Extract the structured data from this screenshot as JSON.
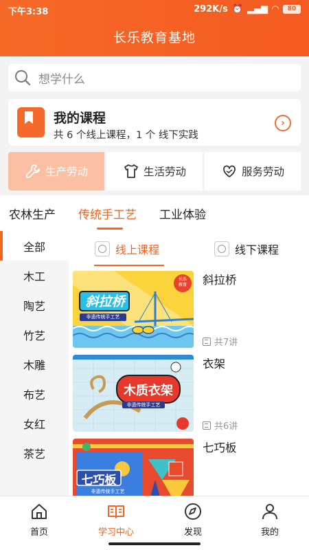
{
  "status": {
    "time": "下午3:38",
    "speed": "292K/s",
    "battery": "80"
  },
  "app": {
    "title": "长乐教育基地"
  },
  "search": {
    "placeholder": "想学什么"
  },
  "my_course": {
    "title": "我的课程",
    "summary": "共 6 个线上课程，1 个 线下实践"
  },
  "categories": [
    {
      "label": "生产劳动",
      "icon": "wrench-icon"
    },
    {
      "label": "生活劳动",
      "icon": "shirt-icon"
    },
    {
      "label": "服务劳动",
      "icon": "heart-hand-icon"
    }
  ],
  "subtabs": [
    "农林生产",
    "传统手工艺",
    "工业体验"
  ],
  "side_items": [
    "全部",
    "木工",
    "陶艺",
    "竹艺",
    "木雕",
    "布艺",
    "女红",
    "茶艺"
  ],
  "content_tabs": [
    "线上课程",
    "线下课程"
  ],
  "courses": [
    {
      "name": "斜拉桥",
      "count": "共7讲",
      "thumb_title": "斜拉桥",
      "thumb_sub": "非遗传统手工艺",
      "badge": "长乐\n教育"
    },
    {
      "name": "衣架",
      "count": "共6讲",
      "thumb_title": "木质衣架",
      "thumb_sub": "非遗传统手工艺"
    },
    {
      "name": "七巧板",
      "count": "",
      "thumb_title": "七巧板",
      "thumb_sub": "非遗传统手工艺"
    }
  ],
  "tabbar": [
    {
      "label": "首页",
      "icon": "home-icon"
    },
    {
      "label": "学习中心",
      "icon": "book-open-icon"
    },
    {
      "label": "发现",
      "icon": "compass-icon"
    },
    {
      "label": "我的",
      "icon": "user-icon"
    }
  ],
  "colors": {
    "accent": "#f2641f",
    "accent_light": "#fbbfa3",
    "header": "#f45a1f"
  }
}
